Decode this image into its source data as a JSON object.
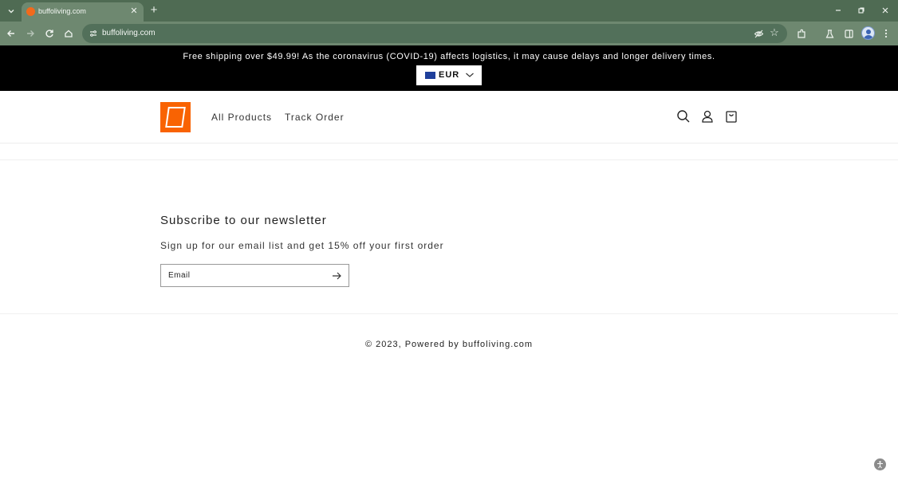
{
  "browser": {
    "tab_title": "buffoliving.com",
    "url": "buffoliving.com",
    "colors": {
      "tabstrip": "#4f6b53",
      "toolbar": "#6e8870"
    }
  },
  "announcement": {
    "text": "Free shipping over $49.99! As the coronavirus (COVID-19) affects logistics, it may cause delays and longer delivery times.",
    "currency": "EUR",
    "flag_icon": "eu-flag-icon"
  },
  "header": {
    "logo_icon": "home-depot-logo",
    "nav": [
      {
        "label": "All Products"
      },
      {
        "label": "Track Order"
      }
    ],
    "icons": [
      "search-icon",
      "account-icon",
      "cart-icon"
    ],
    "logo_color": "#f96302"
  },
  "newsletter": {
    "title": "Subscribe to our newsletter",
    "subtitle": "Sign up for our email list and get 15% off your first order",
    "email_placeholder": "Email"
  },
  "footer": {
    "copyright": "© 2023, Powered by buffoliving.com"
  }
}
